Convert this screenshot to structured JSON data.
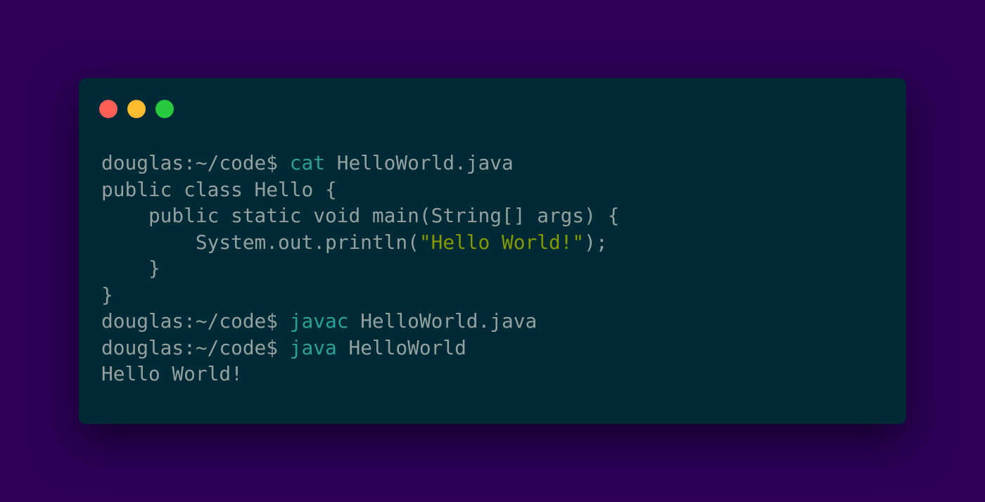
{
  "colors": {
    "background": "#2e0058",
    "window": "#002b36",
    "text": "#93a1a1",
    "command": "#2aa198",
    "string": "#859900",
    "close": "#ff5f56",
    "minimize": "#ffbd2e",
    "maximize": "#27c93f"
  },
  "window_controls": [
    "close",
    "minimize",
    "maximize"
  ],
  "terminal": {
    "line1": {
      "prompt": "douglas:~/code$ ",
      "command": "cat",
      "args": " HelloWorld.java"
    },
    "line2": {
      "text": "public class Hello {"
    },
    "line3": {
      "text": "    public static void main(String[] args) {"
    },
    "line4": {
      "before": "        System.out.println(",
      "string": "\"Hello World!\"",
      "after": ");"
    },
    "line5": {
      "text": "    }"
    },
    "line6": {
      "text": "}"
    },
    "line7": {
      "prompt": "douglas:~/code$ ",
      "command": "javac",
      "args": " HelloWorld.java"
    },
    "line8": {
      "prompt": "douglas:~/code$ ",
      "command": "java",
      "args": " HelloWorld"
    },
    "line9": {
      "text": "Hello World!"
    }
  }
}
